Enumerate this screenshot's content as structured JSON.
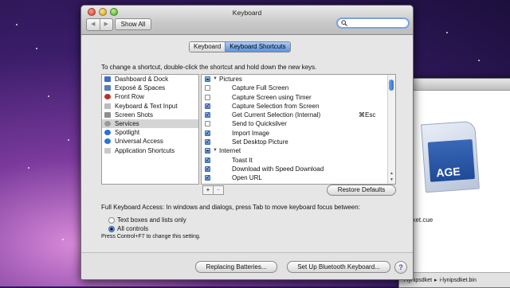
{
  "window": {
    "title": "Keyboard"
  },
  "toolbar": {
    "back_label": "◀",
    "forward_label": "▶",
    "show_all_label": "Show All",
    "search_value": ""
  },
  "tabs": [
    {
      "label": "Keyboard",
      "active": false
    },
    {
      "label": "Keyboard Shortcuts",
      "active": true
    }
  ],
  "instruction": "To change a shortcut, double-click the shortcut and hold down the new keys.",
  "categories": [
    {
      "label": "Dashboard & Dock",
      "icon": "dashboard-icon"
    },
    {
      "label": "Exposé & Spaces",
      "icon": "expose-icon"
    },
    {
      "label": "Front Row",
      "icon": "front-row-icon"
    },
    {
      "label": "Keyboard & Text Input",
      "icon": "keyboard-icon"
    },
    {
      "label": "Screen Shots",
      "icon": "screen-shots-icon"
    },
    {
      "label": "Services",
      "icon": "services-icon",
      "selected": true
    },
    {
      "label": "Spotlight",
      "icon": "spotlight-icon"
    },
    {
      "label": "Universal Access",
      "icon": "universal-access-icon"
    },
    {
      "label": "Application Shortcuts",
      "icon": "app-shortcuts-icon"
    }
  ],
  "shortcuts": [
    {
      "label": "Pictures",
      "group": true,
      "state": "mixed",
      "key": ""
    },
    {
      "label": "Capture Full Screen",
      "state": "off",
      "key": ""
    },
    {
      "label": "Capture Screen using Timer",
      "state": "off",
      "key": ""
    },
    {
      "label": "Capture Selection from Screen",
      "state": "on",
      "key": ""
    },
    {
      "label": "Get Current Selection (Internal)",
      "state": "on",
      "key": "⌘Esc"
    },
    {
      "label": "Send to Quicksilver",
      "state": "off",
      "key": ""
    },
    {
      "label": "Import Image",
      "state": "on",
      "key": ""
    },
    {
      "label": "Set Desktop Picture",
      "state": "on",
      "key": ""
    },
    {
      "label": "Internet",
      "group": true,
      "state": "mixed",
      "key": ""
    },
    {
      "label": "Toast It",
      "state": "on",
      "key": ""
    },
    {
      "label": "Download with Speed Download",
      "state": "on",
      "key": ""
    },
    {
      "label": "Open URL",
      "state": "on",
      "key": ""
    }
  ],
  "list_buttons": {
    "plus": "+",
    "minus": "−"
  },
  "restore_defaults_label": "Restore Defaults",
  "full_keyboard_access": {
    "label": "Full Keyboard Access: In windows and dialogs, press Tab to move keyboard focus between:",
    "options": [
      {
        "label": "Text boxes and lists only",
        "selected": false
      },
      {
        "label": "All controls",
        "selected": true
      }
    ],
    "note": "Press Control+F7 to change this setting."
  },
  "bottom_buttons": {
    "replacing_batteries": "Replacing Batteries...",
    "setup_bluetooth": "Set Up Bluetooth Keyboard...",
    "help": "?"
  },
  "background_window": {
    "file_name": "sdket.cue",
    "icon_text": "AGE",
    "path_items": [
      "i-lynipsdket",
      "i-lynipsdket.bin"
    ]
  },
  "colors": {
    "accent": "#4f86d6",
    "selected_row": "#d4d4d4"
  }
}
